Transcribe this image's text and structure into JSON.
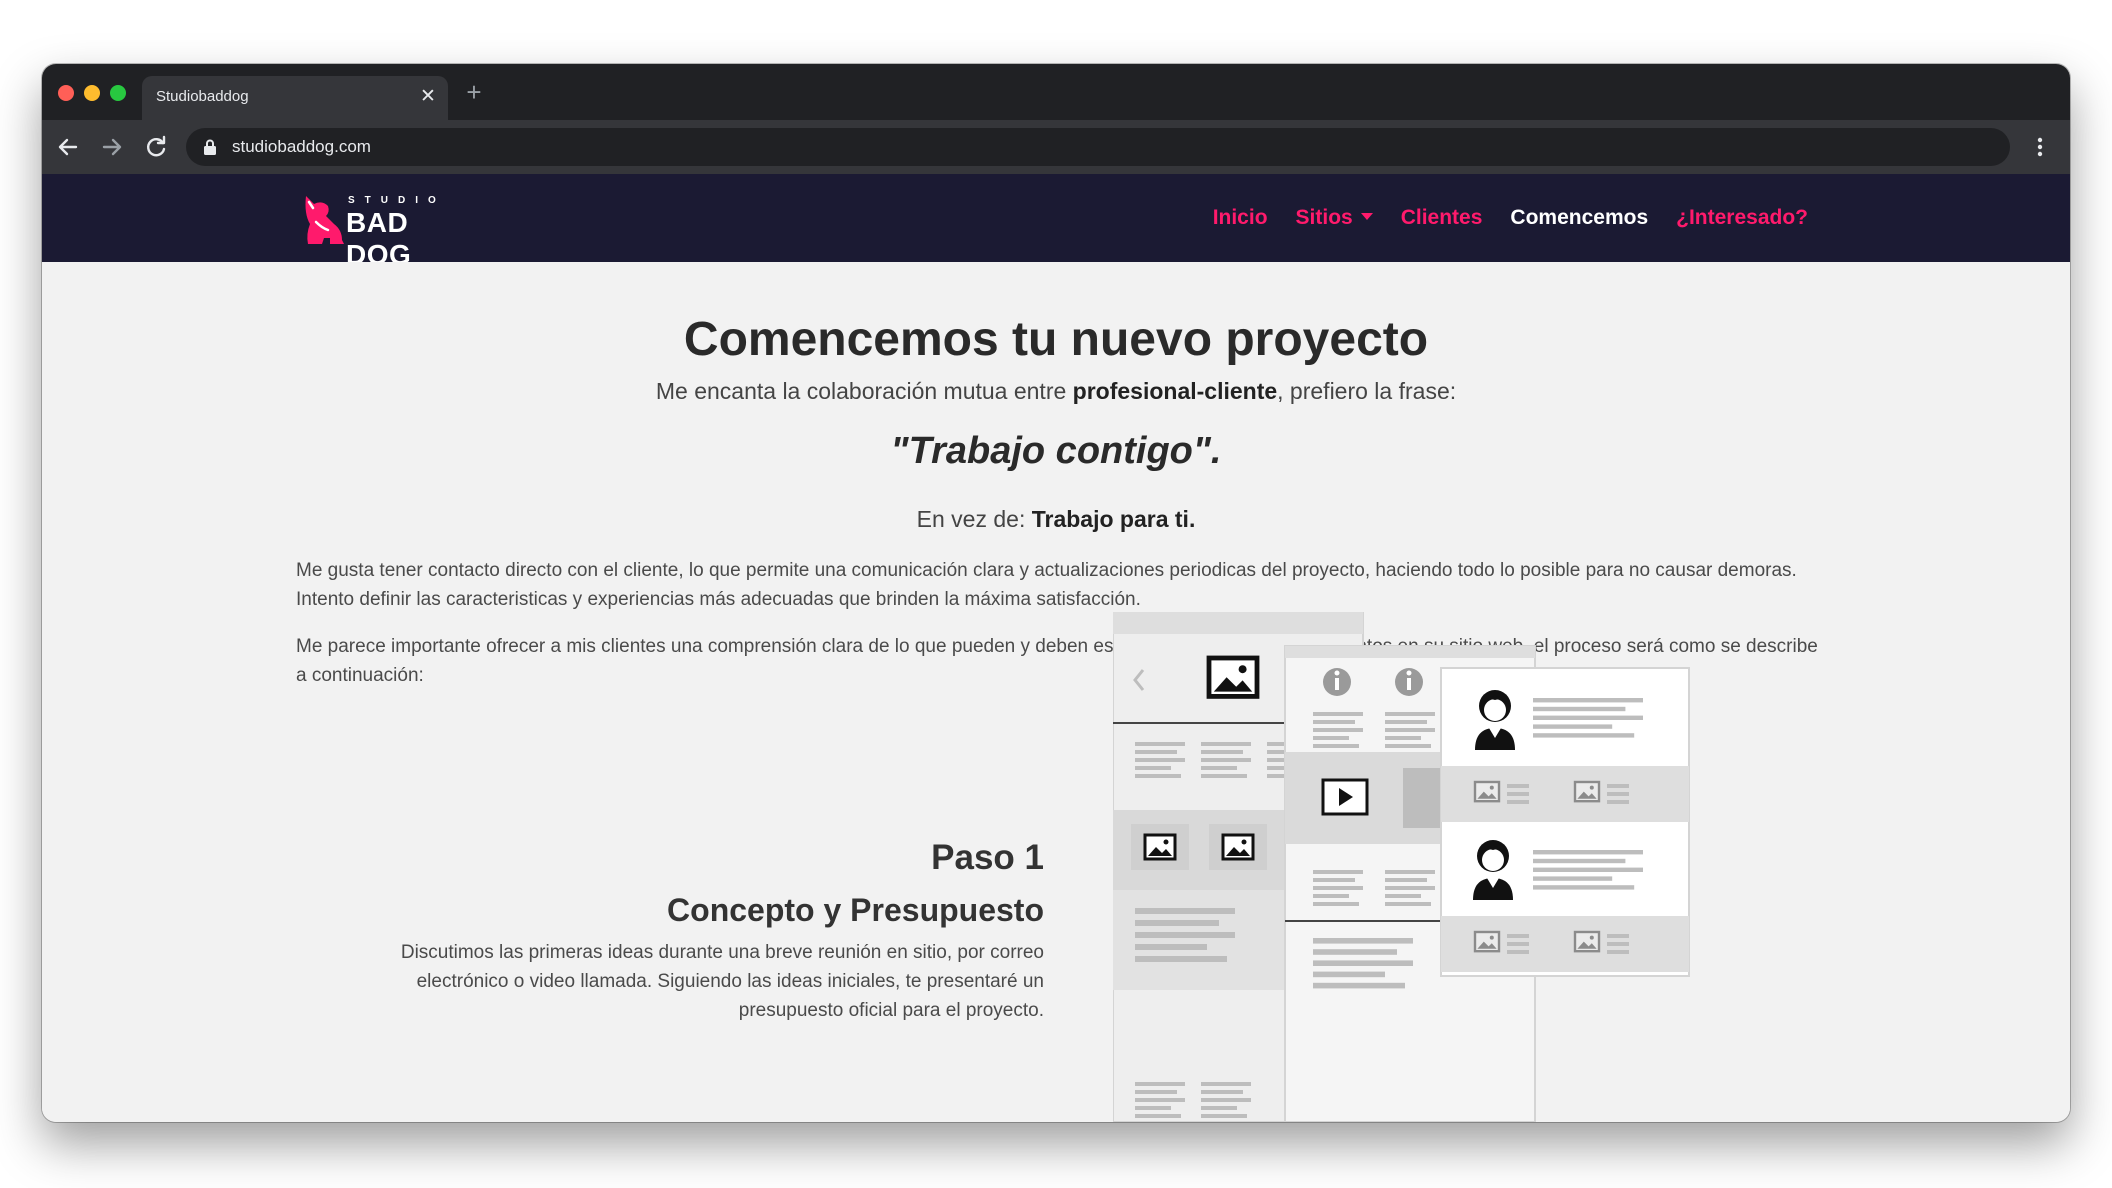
{
  "browser": {
    "tab_title": "Studiobaddog",
    "tab_close": "✕",
    "new_tab": "+",
    "url": "studiobaddog.com"
  },
  "logo": {
    "top": "STUDIO",
    "name": "BAD DOG"
  },
  "nav": {
    "items": [
      {
        "label": "Inicio"
      },
      {
        "label": "Sitios"
      },
      {
        "label": "Clientes"
      },
      {
        "label": "Comencemos"
      },
      {
        "label": "¿Interesado?"
      }
    ]
  },
  "hero": {
    "title": "Comencemos tu nuevo proyecto",
    "intro_before": "Me encanta la colaboración mutua entre ",
    "intro_bold": "profesional-cliente",
    "intro_after": ", prefiero la frase:",
    "quote": "\"Trabajo contigo\".",
    "instead_prefix": "En vez de: ",
    "instead_bold": "Trabajo para ti."
  },
  "paragraphs": [
    "Me gusta tener contacto directo con el cliente, lo que permite una comunicación clara y actualizaciones periodicas del proyecto, haciendo todo lo posible para no causar demoras. Intento definir las caracteristicas y experiencias más adecuadas que brinden la máxima satisfacción.",
    "Me parece importante ofrecer a mis clientes una comprensión clara de lo que pueden y deben esperar de mi. Si trabajamos juntos en su sitio web, el proceso será como se describe a continuación:"
  ],
  "step": {
    "title": "Paso 1",
    "subtitle": "Concepto y Presupuesto",
    "description": "Discutimos las primeras ideas durante una breve reunión en sitio, por correo electrónico o video llamada. Siguiendo las ideas iniciales, te presentaré un presupuesto oficial para el proyecto."
  },
  "colors": {
    "nav_bg": "#1b1a33",
    "accent": "#ff1a6c",
    "page_bg": "#f2f2f2"
  },
  "icons": {
    "back": "back-arrow-icon",
    "forward": "forward-arrow-icon",
    "reload": "reload-icon",
    "lock": "lock-icon",
    "menu": "kebab-menu-icon",
    "logo": "dog-logo-icon"
  }
}
